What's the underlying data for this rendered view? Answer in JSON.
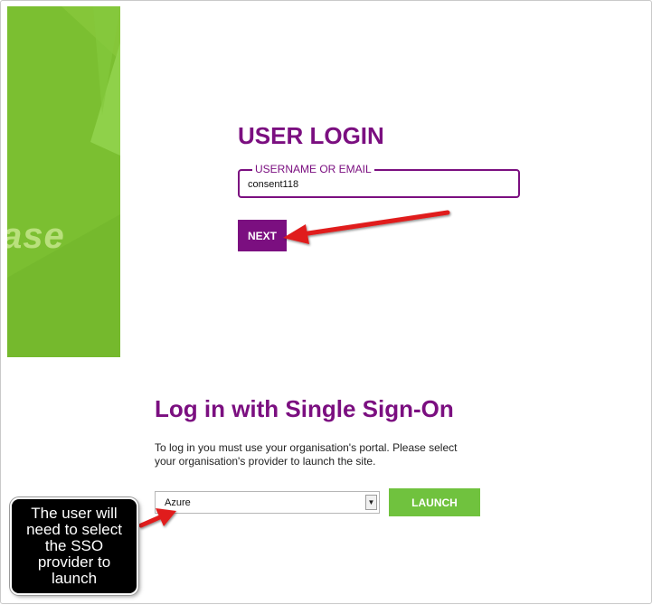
{
  "brand": {
    "partial_text": "ase",
    "color": "#7bbf31"
  },
  "login": {
    "title": "USER LOGIN",
    "field_label": "USERNAME OR EMAIL",
    "field_value": "consent118",
    "next_label": "NEXT",
    "accent": "#7b0f80"
  },
  "sso": {
    "title": "Log in with Single Sign-On",
    "description": "To log in you must use your organisation's portal. Please select your organisation's provider to launch the site.",
    "provider_selected": "Azure",
    "launch_label": "LAUNCH",
    "launch_color": "#70c23e"
  },
  "annotation": {
    "text": "The user will need to select the SSO provider to launch"
  },
  "icons": {
    "select_arrow": "▼"
  }
}
